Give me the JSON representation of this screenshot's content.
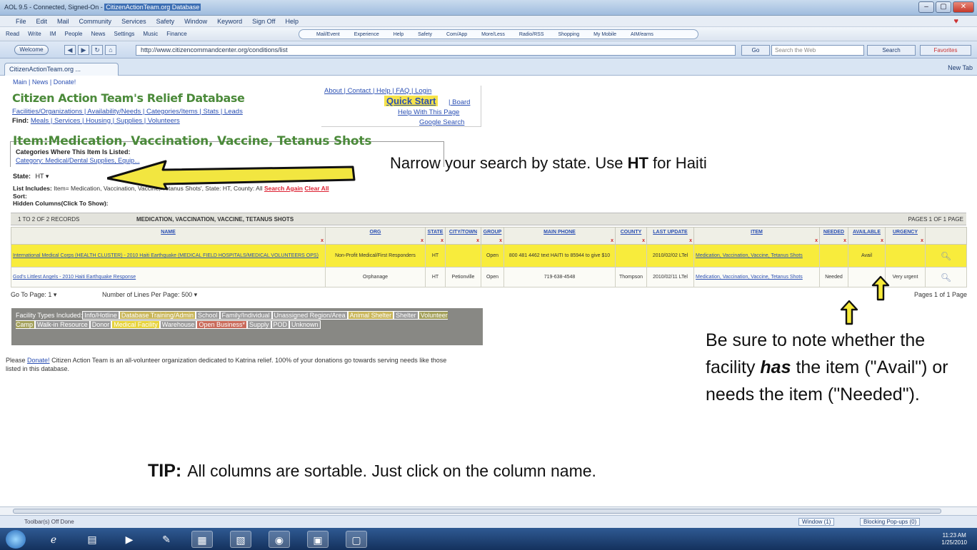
{
  "window": {
    "title": "AOL 9.5 - Connected, Signed-On - ",
    "title_highlight": "CitizenActionTeam.org Database",
    "controls": [
      "–",
      "▢",
      "✕"
    ]
  },
  "menu": [
    "File",
    "Edit",
    "Mail",
    "Community",
    "Services",
    "Safety",
    "Window",
    "Keyword",
    "Sign Off",
    "Help"
  ],
  "aol_toolbar": {
    "left": [
      "Read",
      "Write",
      "IM",
      "People",
      "News",
      "Settings",
      "Music",
      "Finance"
    ],
    "tabs": [
      "Mail/Event",
      "Experience",
      "Help",
      "Safety",
      "Com/App",
      "More/Less",
      "Radio/RSS",
      "Shopping",
      "My Mobile",
      "AIM/earns"
    ]
  },
  "address": {
    "welcome": "Welcome",
    "url": "http://www.citizencommandcenter.org/conditions/list",
    "go": "Go",
    "search_placeholder": "Search the Web",
    "search": "Search",
    "favorites": "Favorites"
  },
  "tab": {
    "label": "CitizenActionTeam.org ...",
    "new_tab": "New Tab"
  },
  "page": {
    "top_links": "Main | News | Donate!",
    "site_title": "Citizen Action Team's Relief Database",
    "nav1": "Facilities/Organizations | Availability/Needs | Categories/Items | Stats | Leads",
    "nav2_label": "Find:",
    "nav2": "Meals | Services | Housing | Supplies | Volunteers",
    "right_links": "About | Contact | Help | FAQ | Login",
    "quick_start": "Quick Start",
    "board": "| Board",
    "help_with_page": "Help With This Page",
    "google_search": "Google Search",
    "item_heading": "Item:Medication, Vaccination, Vaccine, Tetanus Shots",
    "categories_label": "Categories Where This Item Is Listed:",
    "categories_value": "Category: Medical/Dental Supplies, Equip...",
    "state_label": "State:",
    "state_value": "HT",
    "list_includes_label": "List Includes:",
    "list_includes_value": "Item= Medication, Vaccination, Vaccine, Tetanus Shots', State: HT, County: All",
    "search_again": "Search Again",
    "clear_all": "Clear All",
    "sort_label": "Sort:",
    "hidden_columns": "Hidden Columns(Click To Show):"
  },
  "annotations": {
    "state_note_prefix": "Narrow your search by state. Use ",
    "state_note_code": "HT",
    "state_note_suffix": " for Haiti",
    "avail_note_1": "Be sure to note whether the facility ",
    "avail_note_has": "has",
    "avail_note_2": " the item (\"Avail\") or needs the item (\"Needed\").",
    "tip_label": "TIP:",
    "tip_text": "All columns are sortable.  Just click on the column name."
  },
  "results": {
    "records": "1 TO 2 OF 2 RECORDS",
    "category": "MEDICATION, VACCINATION, VACCINE, TETANUS SHOTS",
    "pages": "PAGES 1 OF 1 PAGE",
    "columns": [
      "NAME",
      "ORG",
      "STATE",
      "CITY/TOWN",
      "GROUP",
      "MAIN PHONE",
      "COUNTY",
      "LAST UPDATE",
      "ITEM",
      "NEEDED",
      "AVAILABLE",
      "URGENCY",
      ""
    ],
    "rows": [
      {
        "name": "International Medical Corps (HEALTH CLUSTER) - 2010 Haiti Earthquake (MEDICAL FIELD HOSPITALS/MEDICAL VOLUNTEERS OPS)",
        "org": "Non-Profit Medical/First Responders",
        "state": "HT",
        "city": "",
        "group": "Open",
        "phone": "800 481 4462 text HAITI to 85944 to give $10",
        "county": "",
        "last_update": "2010/02/02 LTel",
        "item": "Medication, Vaccination, Vaccine, Tetanus Shots",
        "needed": "",
        "available": "Avail",
        "urgency": ""
      },
      {
        "name": "God's Littlest Angels - 2010 Haiti Earthquake Response",
        "org": "Orphanage",
        "state": "HT",
        "city": "Petionville",
        "group": "Open",
        "phone": "719-638-4548",
        "county": "Thompson",
        "last_update": "2010/02/11 LTel",
        "item": "Medication, Vaccination, Vaccine, Tetanus Shots",
        "needed": "Needed",
        "available": "",
        "urgency": "Very urgent"
      }
    ],
    "goto_label": "Go To Page:",
    "goto_value": "1",
    "lines_label": "Number of Lines Per Page:",
    "lines_value": "500",
    "pages_bottom": "Pages 1 of 1 Page"
  },
  "facility_types": {
    "label": "Facility Types Included:",
    "items": [
      {
        "label": "Info/Hotline",
        "bg": "#9a9a9a"
      },
      {
        "label": "Database Training/Admin",
        "bg": "#c9b65a"
      },
      {
        "label": "School",
        "bg": "#9a9a9a"
      },
      {
        "label": "Family/Individual",
        "bg": "#9a9a9a"
      },
      {
        "label": "Unassigned Region/Area",
        "bg": "#9a9a9a"
      },
      {
        "label": "Animal Shelter",
        "bg": "#c9b65a"
      },
      {
        "label": "Shelter",
        "bg": "#9a9a9a"
      },
      {
        "label": "Volunteer Camp",
        "bg": "#a3a05a"
      },
      {
        "label": "Walk-in Resource",
        "bg": "#9a9a9a"
      },
      {
        "label": "Donor",
        "bg": "#9a9a9a"
      },
      {
        "label": "Medical Facility",
        "bg": "#e6d23a"
      },
      {
        "label": "Warehouse",
        "bg": "#9a9a9a"
      },
      {
        "label": "Open Business*",
        "bg": "#c96a5a"
      },
      {
        "label": "Supply",
        "bg": "#9a9a9a"
      },
      {
        "label": "POD",
        "bg": "#9a9a9a"
      },
      {
        "label": "Unknown",
        "bg": "#9a9a9a"
      }
    ]
  },
  "donate": {
    "prefix": "Please ",
    "link": "Donate!",
    "text": " Citizen Action Team is an all-volunteer organization dedicated to Katrina relief. 100% of your donations go towards serving needs like those listed in this database."
  },
  "status": {
    "left": "Toolbar(s) Off  Done",
    "window": "Window (1)",
    "popups": "Blocking Pop-ups (0)"
  },
  "clock": {
    "time": "11:23 AM",
    "date": "1/25/2010"
  },
  "colors": {
    "title_green": "#4b8a3a",
    "link_blue": "#2a4fb3",
    "highlight_yellow": "#f8ec3c",
    "quickstart_yellow": "#f6e34a"
  }
}
